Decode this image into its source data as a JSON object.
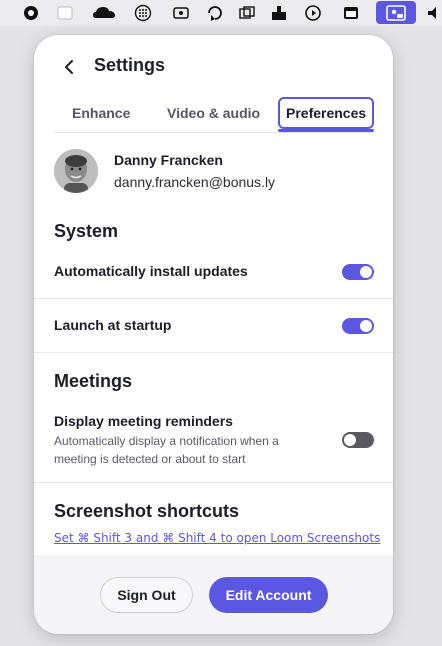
{
  "settings": {
    "title": "Settings",
    "tabs": [
      {
        "label": "Enhance"
      },
      {
        "label": "Video & audio"
      },
      {
        "label": "Preferences"
      }
    ],
    "active_tab": "Preferences",
    "user": {
      "name": "Danny Francken",
      "email": "danny.francken@bonus.ly"
    },
    "system": {
      "title": "System",
      "auto_update_label": "Automatically install updates",
      "auto_update_enabled": true,
      "launch_startup_label": "Launch at startup",
      "launch_startup_enabled": true
    },
    "meetings": {
      "title": "Meetings",
      "reminders_label": "Display meeting reminders",
      "reminders_desc": "Automatically display a notification when a meeting is detected or about to start",
      "reminders_enabled": false
    },
    "shortcuts": {
      "title": "Screenshot shortcuts",
      "link_text": "Set ⌘ Shift 3 and ⌘ Shift 4 to open Loom Screenshots"
    },
    "footer": {
      "sign_out_label": "Sign Out",
      "edit_account_label": "Edit Account"
    }
  },
  "menubar": {
    "icons": [
      "app-icon",
      "window-icon",
      "cloud-icon",
      "grid-icon",
      "camera-icon",
      "sync-icon",
      "copy-icon",
      "storage-icon",
      "refresh-icon",
      "terminal-icon",
      "loom-icon",
      "audio-icon"
    ]
  },
  "colors": {
    "accent": "#5b57e0",
    "toggle_off": "#5a5a60",
    "footer_bg": "#f5f5f7"
  }
}
